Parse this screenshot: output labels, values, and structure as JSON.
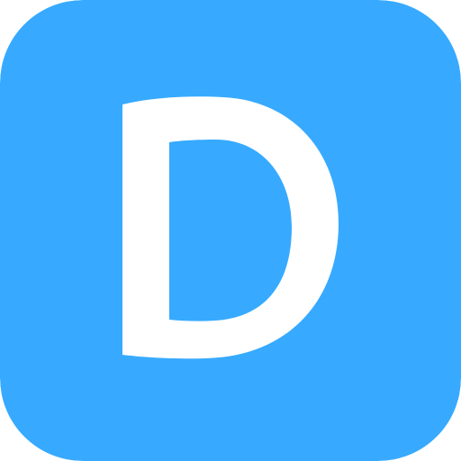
{
  "icon": {
    "name": "d-letter-app-icon",
    "letter": "D",
    "background_color": "#37AAFF",
    "foreground_color": "#FFFFFF"
  }
}
